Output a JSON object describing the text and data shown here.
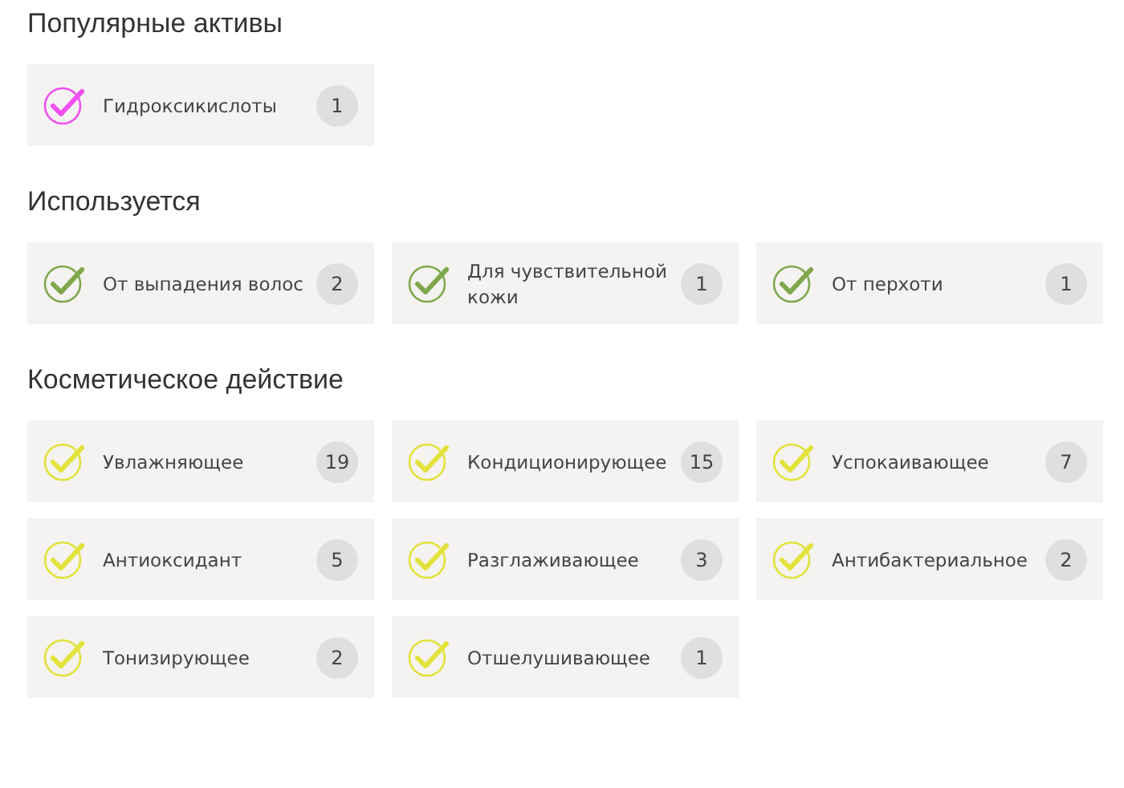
{
  "sections": [
    {
      "title": "Популярные активы",
      "items": [
        {
          "label": "Гидроксикислоты",
          "count": "1",
          "color": "#f050f0"
        }
      ]
    },
    {
      "title": "Используется",
      "items": [
        {
          "label": "От выпадения волос",
          "count": "2",
          "color": "#7fa84c"
        },
        {
          "label": "Для чувствительной кожи",
          "count": "1",
          "color": "#7fa84c"
        },
        {
          "label": "От перхоти",
          "count": "1",
          "color": "#7fa84c"
        }
      ]
    },
    {
      "title": "Косметическое действие",
      "items": [
        {
          "label": "Увлажняющее",
          "count": "19",
          "color": "#e2e23a"
        },
        {
          "label": "Кондиционирующее",
          "count": "15",
          "color": "#e2e23a"
        },
        {
          "label": "Успокаивающее",
          "count": "7",
          "color": "#e2e23a"
        },
        {
          "label": "Антиоксидант",
          "count": "5",
          "color": "#e2e23a"
        },
        {
          "label": "Разглаживающее",
          "count": "3",
          "color": "#e2e23a"
        },
        {
          "label": "Антибактериальное",
          "count": "2",
          "color": "#e2e23a"
        },
        {
          "label": "Тонизирующее",
          "count": "2",
          "color": "#e2e23a"
        },
        {
          "label": "Отшелушивающее",
          "count": "1",
          "color": "#e2e23a"
        }
      ]
    }
  ]
}
